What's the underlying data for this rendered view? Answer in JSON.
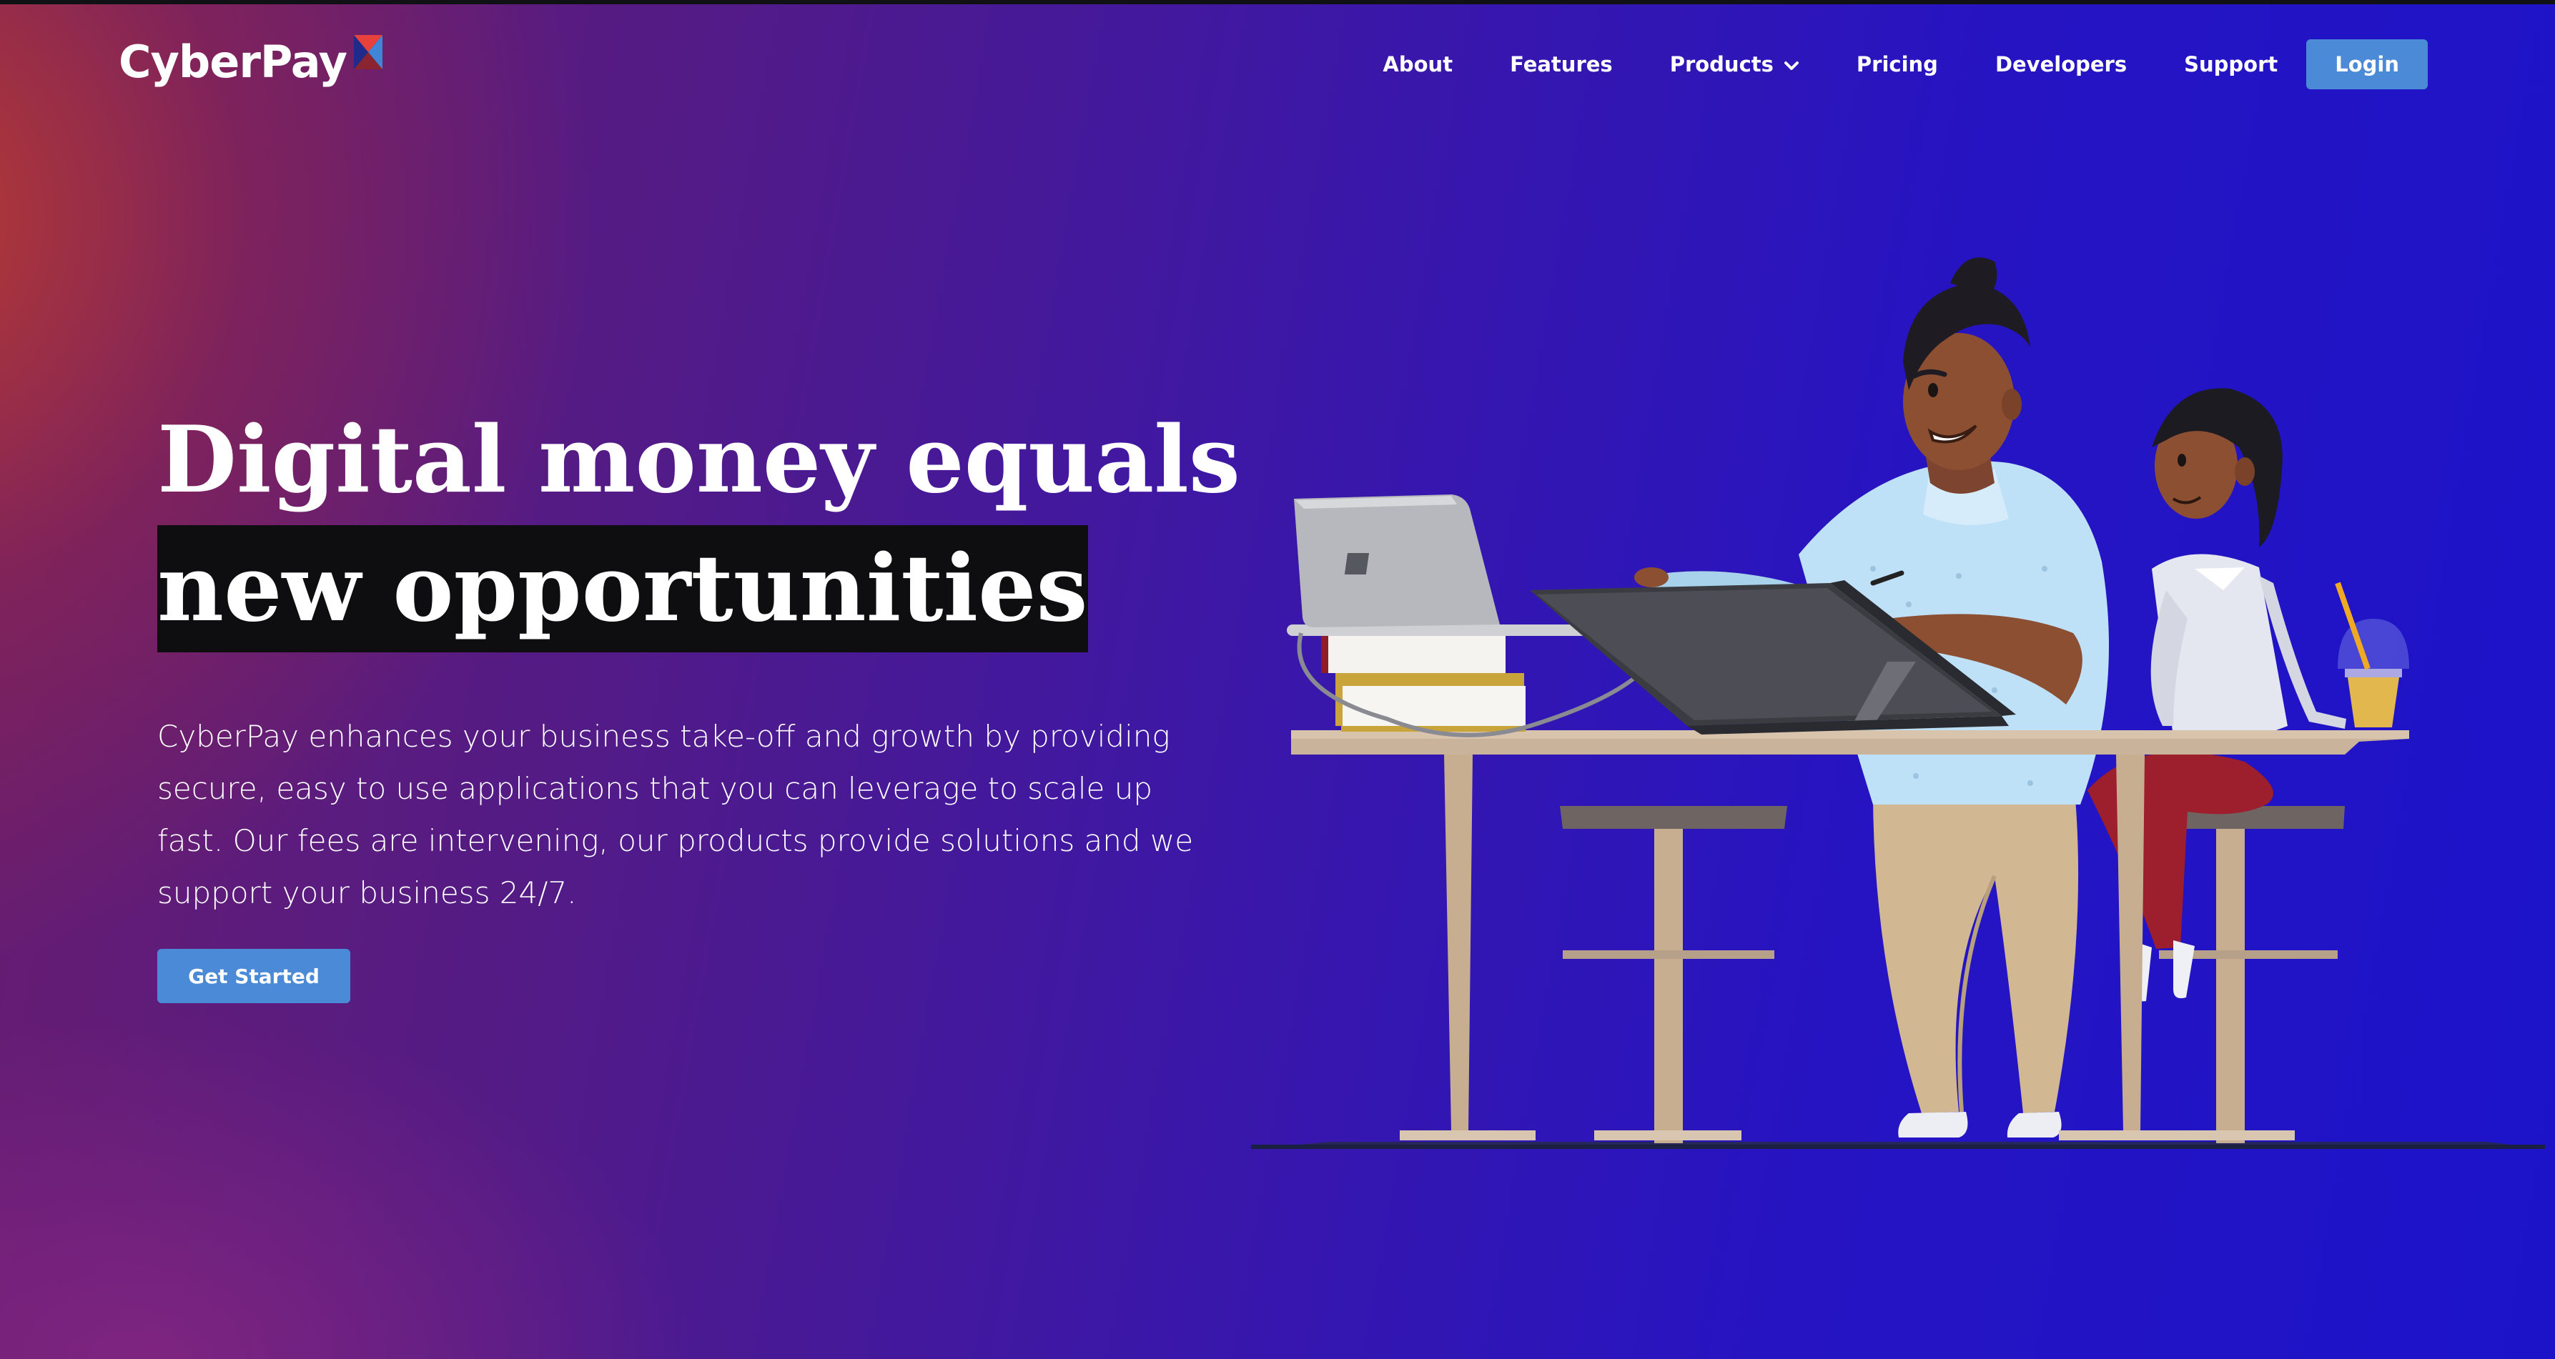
{
  "brand": {
    "name": "CyberPay",
    "logo_icon": "cyberpay-logo-mark",
    "colors": {
      "accent_button": "#4a8ad6",
      "highlight_bg": "#0e0e10",
      "gradient_left": "#be3e2c",
      "gradient_right": "#1c13c9"
    }
  },
  "nav": {
    "items": [
      {
        "label": "About"
      },
      {
        "label": "Features"
      },
      {
        "label": "Products",
        "has_dropdown": true,
        "icon": "chevron-down-icon"
      },
      {
        "label": "Pricing"
      },
      {
        "label": "Developers"
      },
      {
        "label": "Support"
      }
    ],
    "login_label": "Login"
  },
  "hero": {
    "headline_line1": "Digital money equals",
    "headline_line2": "new opportunities",
    "description": "CyberPay enhances your business take-off and growth by providing secure, easy to use applications that you can leverage to scale up fast. Our fees are intervening, our products provide solutions and we support your business 24/7.",
    "cta_label": "Get Started"
  },
  "illustration": {
    "subject": "two people working at a high table with a laptop and drawing tablet",
    "icon": "coworkers-illustration"
  }
}
